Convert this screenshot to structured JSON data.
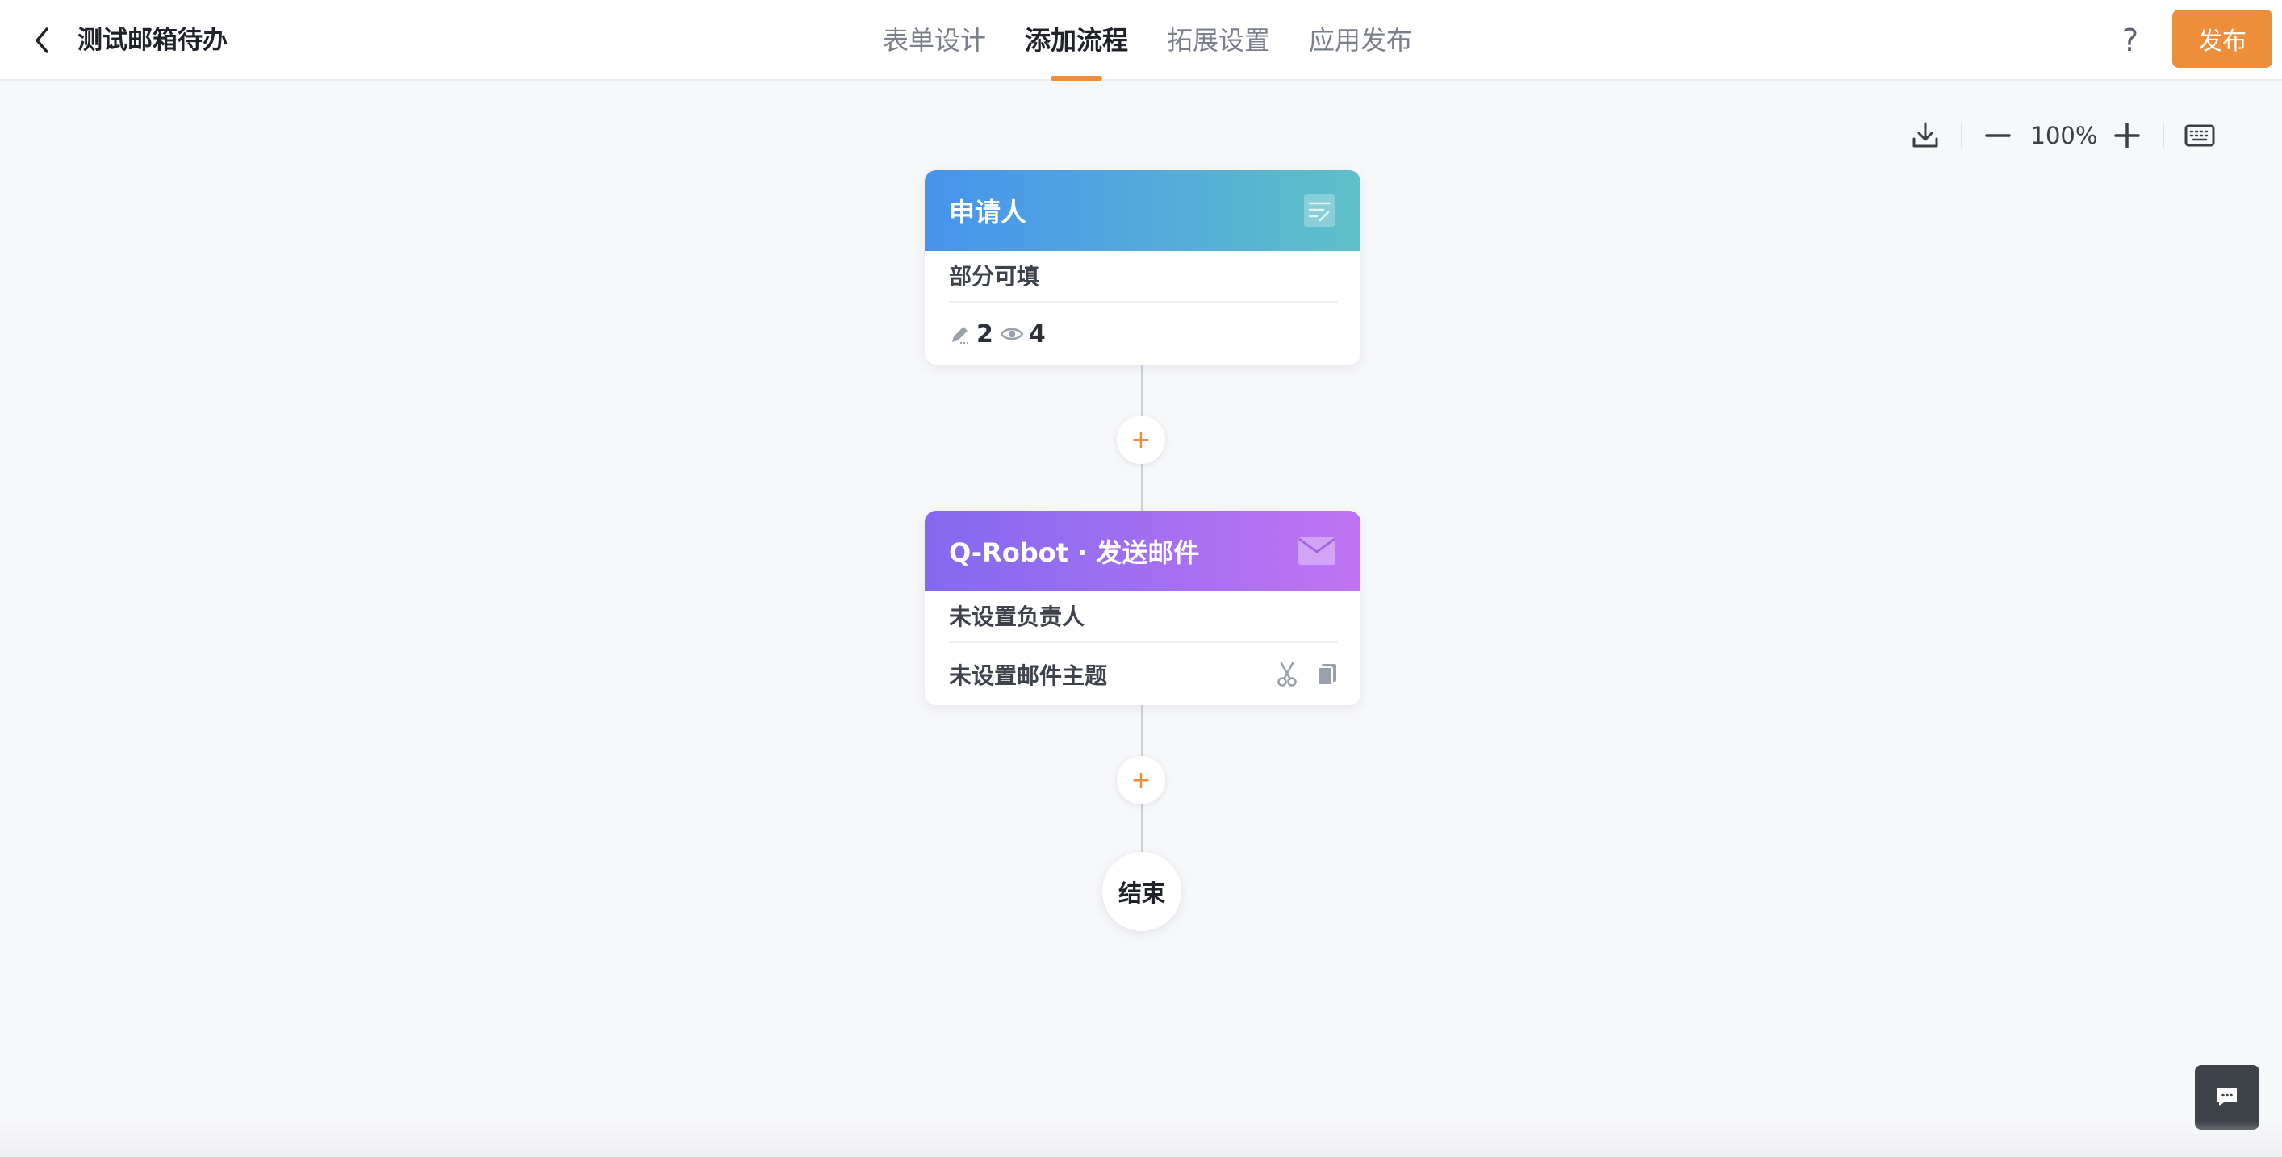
{
  "header": {
    "title": "测试邮箱待办",
    "tabs": [
      {
        "label": "表单设计",
        "active": false
      },
      {
        "label": "添加流程",
        "active": true
      },
      {
        "label": "拓展设置",
        "active": false
      },
      {
        "label": "应用发布",
        "active": false
      }
    ],
    "help_label": "?",
    "publish_label": "发布"
  },
  "toolbar": {
    "zoom_level": "100%",
    "icons": [
      "download-icon",
      "zoom-out-icon",
      "zoom-in-icon",
      "keyboard-icon"
    ]
  },
  "flow": {
    "applicant_node": {
      "title": "申请人",
      "permission": "部分可填",
      "editable_count": "2",
      "visible_count": "4",
      "icon": "form-edit-icon"
    },
    "robot_node": {
      "title": "Q-Robot · 发送邮件",
      "assignee": "未设置负责人",
      "subject": "未设置邮件主题",
      "icon": "mail-icon"
    },
    "add_button_label": "+",
    "end_label": "结束"
  },
  "colors": {
    "accent": "#ee8e3a",
    "applicant_gradient": [
      "#4793ee",
      "#5fc0c8"
    ],
    "robot_gradient": [
      "#8369f0",
      "#c074f3"
    ]
  }
}
